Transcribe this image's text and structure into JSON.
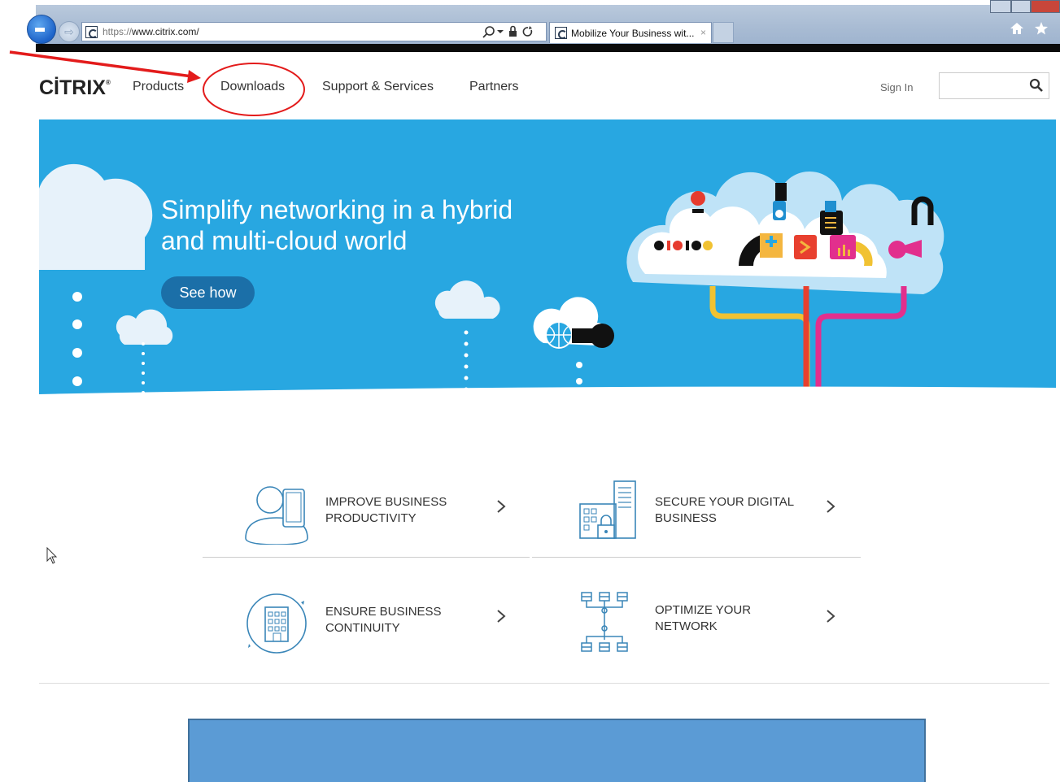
{
  "browser": {
    "url_prefix": "https://",
    "url_host": "www.citrix.com/",
    "tab_title": "Mobilize Your Business wit...",
    "tab_close": "×",
    "fwd_glyph": "⇨"
  },
  "header": {
    "logo": "CİTRIX",
    "nav": [
      "Products",
      "Downloads",
      "Support & Services",
      "Partners"
    ],
    "sign_in": "Sign In",
    "search_placeholder": ""
  },
  "hero": {
    "title": "Simplify networking in a hybrid and multi-cloud world",
    "button": "See how"
  },
  "tiles": [
    {
      "label": "IMPROVE BUSINESS PRODUCTIVITY",
      "icon": "person-tablet-icon"
    },
    {
      "label": "SECURE YOUR DIGITAL BUSINESS",
      "icon": "secure-building-icon"
    },
    {
      "label": "ENSURE BUSINESS CONTINUITY",
      "icon": "building-cycle-icon"
    },
    {
      "label": "OPTIMIZE YOUR NETWORK",
      "icon": "network-nodes-icon"
    }
  ],
  "colors": {
    "hero_blue": "#28a7e1",
    "hero_button": "#1b6fa8",
    "annotation_red": "#e31b1b",
    "overlay_box": "#5b9bd5"
  }
}
